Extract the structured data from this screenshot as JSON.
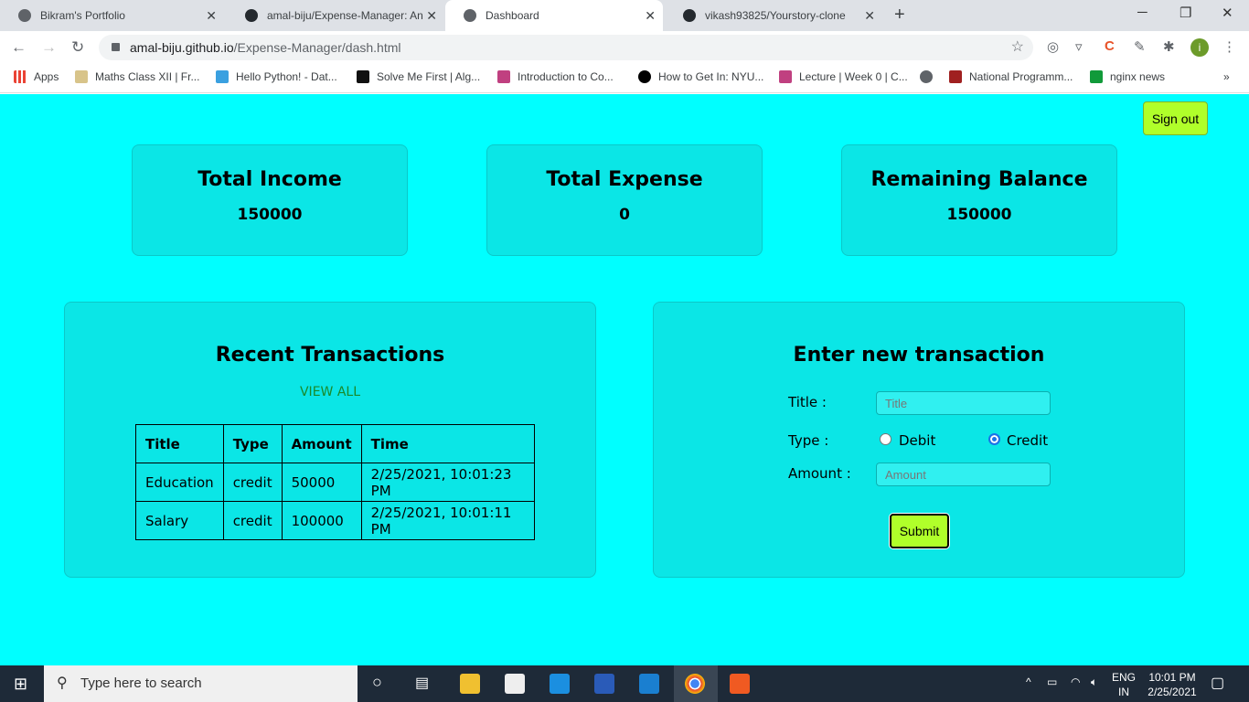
{
  "browser": {
    "tabs": [
      {
        "label": "Bikram's Portfolio",
        "icon": "globe-icon"
      },
      {
        "label": "amal-biju/Expense-Manager: An",
        "icon": "github-icon"
      },
      {
        "label": "Dashboard",
        "icon": "globe-icon",
        "active": true
      },
      {
        "label": "vikash93825/Yourstory-clone",
        "icon": "github-icon"
      }
    ],
    "url_host": "amal-biju.github.io",
    "url_path": "/Expense-Manager/dash.html",
    "profile_initial": "i",
    "bookmarks": [
      {
        "label": "Apps",
        "color": "#4285f4"
      },
      {
        "label": "Maths Class XII | Fr...",
        "color": "#d8c48a"
      },
      {
        "label": "Hello Python! - Dat...",
        "color": "#3aa0e0"
      },
      {
        "label": "Solve Me First | Alg...",
        "color": "#111"
      },
      {
        "label": "Introduction to Co...",
        "color": "#c04080"
      },
      {
        "label": "How to Get In: NYU...",
        "color": "#000"
      },
      {
        "label": "Lecture | Week 0 | C...",
        "color": "#c04080"
      },
      {
        "label": "National Programm...",
        "color": "#a02020"
      },
      {
        "label": "nginx news",
        "color": "#119a3a"
      }
    ]
  },
  "page": {
    "signout": "Sign out",
    "stats": [
      {
        "title": "Total Income",
        "value": "150000"
      },
      {
        "title": "Total Expense",
        "value": "0"
      },
      {
        "title": "Remaining Balance",
        "value": "150000"
      }
    ],
    "recent": {
      "title": "Recent Transactions",
      "view_all": "VIEW ALL",
      "headers": [
        "Title",
        "Type",
        "Amount",
        "Time"
      ],
      "rows": [
        [
          "Education",
          "credit",
          "50000",
          "2/25/2021, 10:01:23 PM"
        ],
        [
          "Salary",
          "credit",
          "100000",
          "2/25/2021, 10:01:11 PM"
        ]
      ]
    },
    "form": {
      "title": "Enter new transaction",
      "title_label": "Title :",
      "title_placeholder": "Title",
      "type_label": "Type :",
      "debit": "Debit",
      "credit": "Credit",
      "selected": "Credit",
      "amount_label": "Amount :",
      "amount_placeholder": "Amount",
      "submit": "Submit"
    }
  },
  "taskbar": {
    "search_placeholder": "Type here to search",
    "lang1": "ENG",
    "lang2": "IN",
    "time": "10:01 PM",
    "date": "2/25/2021"
  }
}
